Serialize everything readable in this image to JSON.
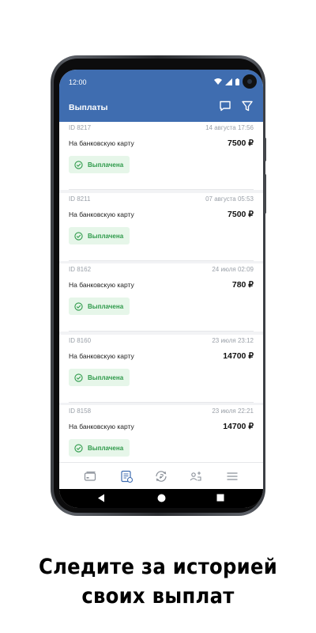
{
  "status_bar": {
    "time": "12:00"
  },
  "header": {
    "title": "Выплаты"
  },
  "payouts": [
    {
      "id": "ID 8217",
      "date": "14 августа 17:56",
      "type": "На банковскую карту",
      "amount": "7500 ₽",
      "status": "Выплачена"
    },
    {
      "id": "ID 8211",
      "date": "07 августа 05:53",
      "type": "На банковскую карту",
      "amount": "7500 ₽",
      "status": "Выплачена"
    },
    {
      "id": "ID 8162",
      "date": "24 июля 02:09",
      "type": "На банковскую карту",
      "amount": "780 ₽",
      "status": "Выплачена"
    },
    {
      "id": "ID 8160",
      "date": "23 июля 23:12",
      "type": "На банковскую карту",
      "amount": "14700 ₽",
      "status": "Выплачена"
    },
    {
      "id": "ID 8158",
      "date": "23 июля 22:21",
      "type": "На банковскую карту",
      "amount": "14700 ₽",
      "status": "Выплачена"
    }
  ],
  "caption": {
    "line1": "Следите за историей",
    "line2": "своих выплат"
  },
  "colors": {
    "header": "#3f6db0",
    "status_ok": "#2e9a4a",
    "status_bg": "#e6f6e9",
    "active_tab": "#3f6db0"
  },
  "tabs": [
    "card-icon",
    "payouts-list-icon",
    "exchange-icon",
    "referral-icon",
    "menu-icon"
  ]
}
